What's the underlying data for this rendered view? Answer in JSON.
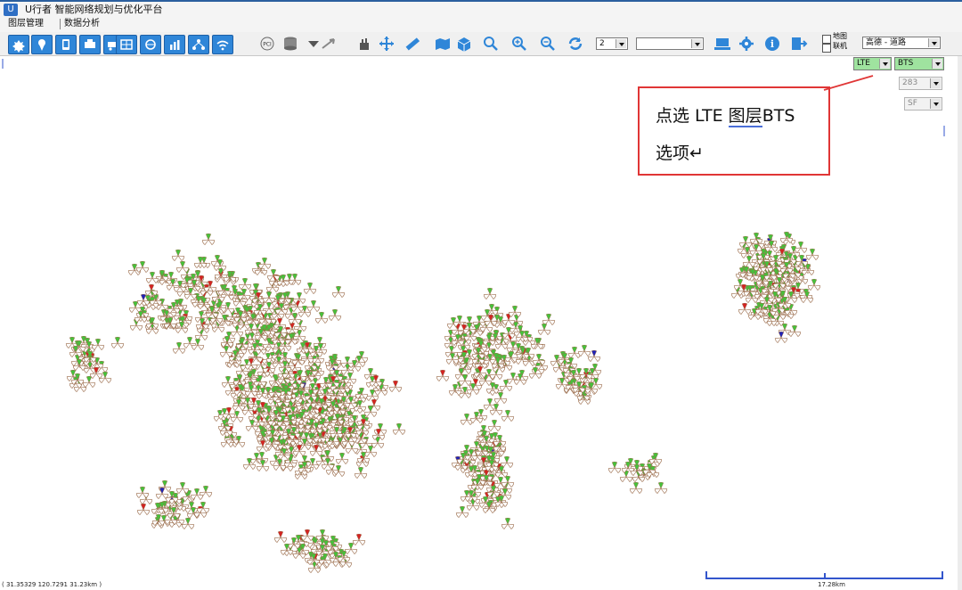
{
  "window": {
    "title": "U行者 智能网络规划与优化平台",
    "app_icon": "U"
  },
  "menu": {
    "items": [
      "图层管理",
      "数据分析"
    ]
  },
  "toolbar": {
    "zoom_level": "2",
    "select_value": "",
    "map_checkbox": "地图",
    "online_checkbox": "联机",
    "map_style": "高德 - 道路"
  },
  "layer_panel": {
    "network": "LTE",
    "layer": "BTS",
    "band": "283",
    "option": "SF"
  },
  "callout": {
    "line1_pre": "点选 LTE ",
    "line1_underlined": "图层",
    "line1_post": "BTS",
    "line2": "选项↵"
  },
  "status": {
    "coordinates": "( 31.35329 120.7291 31.23km )",
    "scale": "17.28km"
  },
  "colors": {
    "site_green": "#45c23b",
    "site_red": "#d42222",
    "site_blue": "#1f23b8",
    "site_outline": "#9a6b4a",
    "callout_border": "#e03636",
    "toolbar_blue": "#2f86d8",
    "scale_bar": "#3355cc"
  },
  "icons": [
    "gear-icon",
    "pin-icon",
    "phone-icon",
    "truck-icon",
    "grid-icon",
    "globe-icon",
    "chart-icon",
    "tree-icon",
    "wifi-icon",
    "pci-icon",
    "database-icon",
    "arrow-icon",
    "hand-icon",
    "move-icon",
    "ruler-icon",
    "map-icon",
    "cube-icon",
    "zoom-icon",
    "zoom-in-icon",
    "zoom-out-icon",
    "refresh-icon",
    "monitor-icon",
    "settings-icon",
    "info-icon",
    "exit-icon"
  ]
}
